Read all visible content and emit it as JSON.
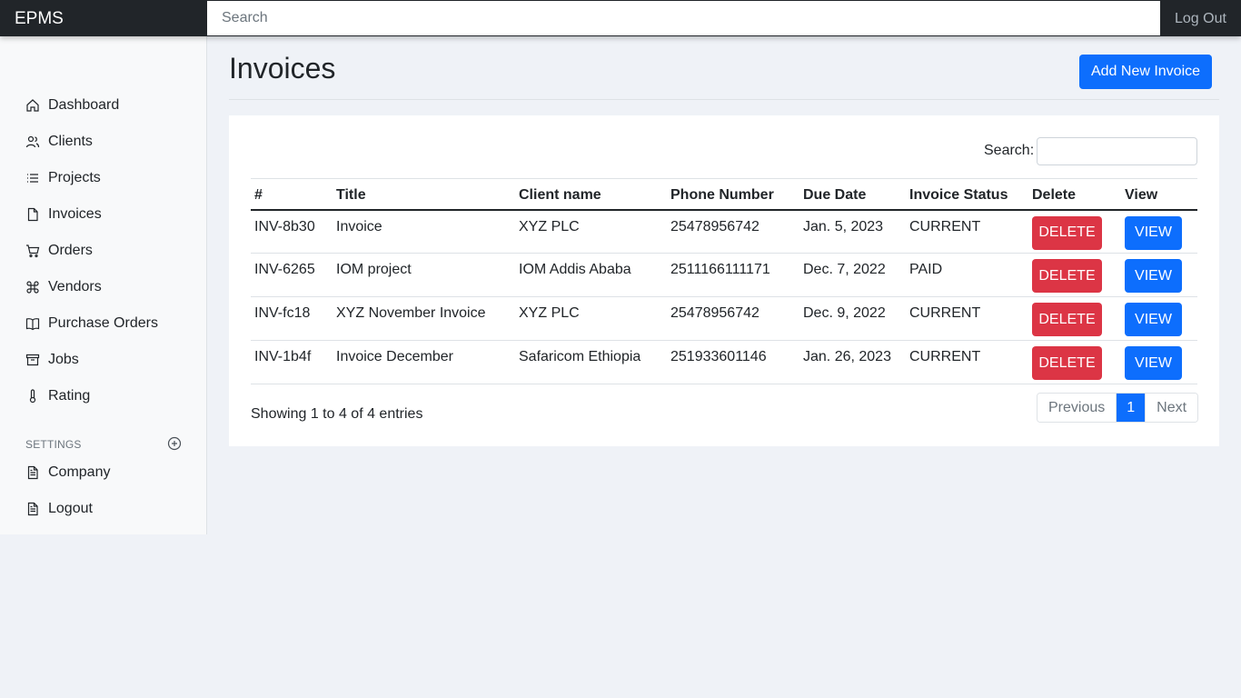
{
  "navbar": {
    "brand": "EPMS",
    "search_placeholder": "Search",
    "logout_label": "Log Out"
  },
  "sidebar": {
    "items": [
      {
        "label": "Dashboard",
        "icon": "house-icon"
      },
      {
        "label": "Clients",
        "icon": "users-icon"
      },
      {
        "label": "Projects",
        "icon": "list-icon"
      },
      {
        "label": "Invoices",
        "icon": "file-icon"
      },
      {
        "label": "Orders",
        "icon": "cart-icon"
      },
      {
        "label": "Vendors",
        "icon": "command-icon"
      },
      {
        "label": "Purchase Orders",
        "icon": "book-icon"
      },
      {
        "label": "Jobs",
        "icon": "archive-icon"
      },
      {
        "label": "Rating",
        "icon": "thermometer-icon"
      }
    ],
    "settings_heading": "SETTINGS",
    "settings_items": [
      {
        "label": "Company",
        "icon": "file-text-icon"
      },
      {
        "label": "Logout",
        "icon": "file-text-icon"
      }
    ]
  },
  "main": {
    "title": "Invoices",
    "add_button": "Add New Invoice",
    "search_label": "Search:",
    "columns": [
      "#",
      "Title",
      "Client name",
      "Phone Number",
      "Due Date",
      "Invoice Status",
      "Delete",
      "View"
    ],
    "rows": [
      {
        "id": "INV-8b30",
        "title": "Invoice",
        "client": "XYZ PLC",
        "phone": "25478956742",
        "due": "Jan. 5, 2023",
        "status": "CURRENT",
        "delete": "DELETE",
        "view": "VIEW"
      },
      {
        "id": "INV-6265",
        "title": "IOM project",
        "client": "IOM Addis Ababa",
        "phone": "2511166111171",
        "due": "Dec. 7, 2022",
        "status": "PAID",
        "delete": "DELETE",
        "view": "VIEW"
      },
      {
        "id": "INV-fc18",
        "title": "XYZ November Invoice",
        "client": "XYZ PLC",
        "phone": "25478956742",
        "due": "Dec. 9, 2022",
        "status": "CURRENT",
        "delete": "DELETE",
        "view": "VIEW"
      },
      {
        "id": "INV-1b4f",
        "title": "Invoice December",
        "client": "Safaricom Ethiopia",
        "phone": "251933601146",
        "due": "Jan. 26, 2023",
        "status": "CURRENT",
        "delete": "DELETE",
        "view": "VIEW"
      }
    ],
    "showing": "Showing 1 to 4 of 4 entries",
    "pagination": {
      "previous": "Previous",
      "current": "1",
      "next": "Next"
    }
  },
  "colors": {
    "navbar": "#212529",
    "primary": "#0d6efd",
    "danger": "#dc3545",
    "background": "#eff2f7"
  }
}
